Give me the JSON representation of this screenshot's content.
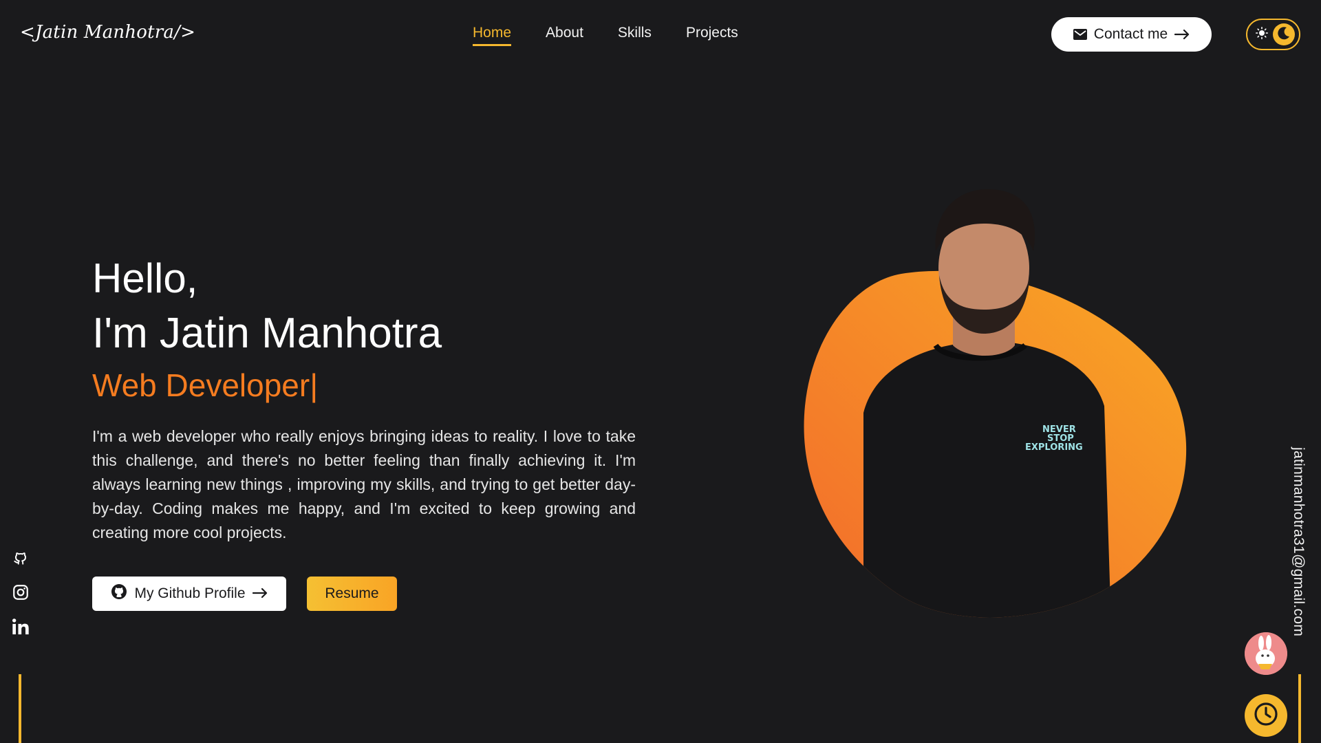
{
  "header": {
    "logo": "<Jatin Manhotra/>",
    "nav": [
      {
        "label": "Home",
        "active": true
      },
      {
        "label": "About",
        "active": false
      },
      {
        "label": "Skills",
        "active": false
      },
      {
        "label": "Projects",
        "active": false
      }
    ],
    "contact_label": "Contact me",
    "theme_toggle": {
      "light_icon": "sun-icon",
      "dark_icon": "moon-icon",
      "mode": "dark"
    }
  },
  "hero": {
    "greeting": "Hello,",
    "name": "I'm Jatin Manhotra",
    "role": "Web Developer",
    "cursor": "|",
    "bio": "I'm a web developer who really enjoys bringing ideas to reality. I love to take this challenge, and there's no better feeling than finally achieving it. I'm always learning new things , improving my skills, and trying to get better day-by-day. Coding makes me happy, and I'm excited to keep growing and creating more cool projects.",
    "github_label": "My Github Profile",
    "resume_label": "Resume"
  },
  "social": {
    "icons": [
      "github-icon",
      "instagram-icon",
      "linkedin-icon"
    ]
  },
  "side": {
    "email": "jatinmanhotra31@gmail.com"
  },
  "colors": {
    "background": "#1a1a1c",
    "accent_yellow": "#f5b82e",
    "accent_orange": "#f57c20"
  }
}
